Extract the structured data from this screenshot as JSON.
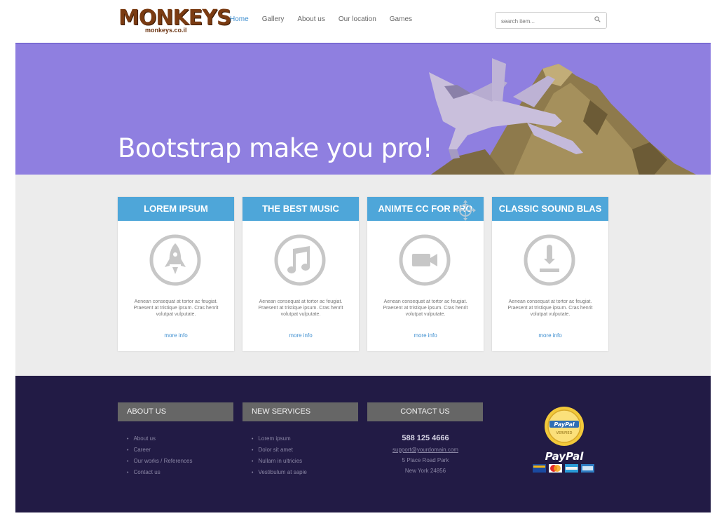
{
  "header": {
    "logo_text": "MONKEYS",
    "logo_domain": "monkeys.co.il",
    "nav": [
      "Home",
      "Gallery",
      "About us",
      "Our location",
      "Games"
    ],
    "search_placeholder": "search item..."
  },
  "hero": {
    "title": "Bootstrap make you pro!"
  },
  "cards": [
    {
      "title": "LOREM IPSUM",
      "icon": "rocket-icon",
      "text": "Aenean consequat at tortor ac feugiat. Praesent at tristique ipsum. Cras henrit volutpat vulputate.",
      "link": "more info"
    },
    {
      "title": "THE BEST MUSIC",
      "icon": "music-note-icon",
      "text": "Aenean consequat at tortor ac feugiat. Praesent at tristique ipsum. Cras henrit volutpat vulputate.",
      "link": "more info"
    },
    {
      "title": "ANIMTE CC FOR PRO",
      "icon": "video-camera-icon",
      "text": "Aenean consequat at tortor ac feugiat. Praesent at tristique ipsum. Cras henrit volutpat vulputate.",
      "link": "more info"
    },
    {
      "title": "CLASSIC SOUND BLAS",
      "icon": "microphone-icon",
      "text": "Aenean consequat at tortor ac feugiat. Praesent at tristique ipsum. Cras henrit volutpat vulputate.",
      "link": "more info"
    }
  ],
  "footer": {
    "about": {
      "title": "ABOUT US",
      "items": [
        "About us",
        "Career",
        "Our works / References",
        "Contact us"
      ]
    },
    "services": {
      "title": "NEW SERVICES",
      "items": [
        "Lorem ipsum",
        "Dolor sit amet",
        "Nullam in ultricies",
        "Vestibulum at sapie"
      ]
    },
    "contact": {
      "title": "CONTACT US",
      "phone": "588 125 4666",
      "email": "support@yourdomain.com",
      "address1": "5 Place Road Park",
      "address2": "New York 24856"
    },
    "paypal": {
      "seal_top": "PayPal",
      "seal_bottom": "VERIFIED",
      "logo": "PayPal"
    }
  },
  "colors": {
    "accent": "#4ea6d9",
    "hero_bg": "#8f7fe0",
    "footer_bg": "#221b45",
    "link": "#3f8fd0"
  }
}
